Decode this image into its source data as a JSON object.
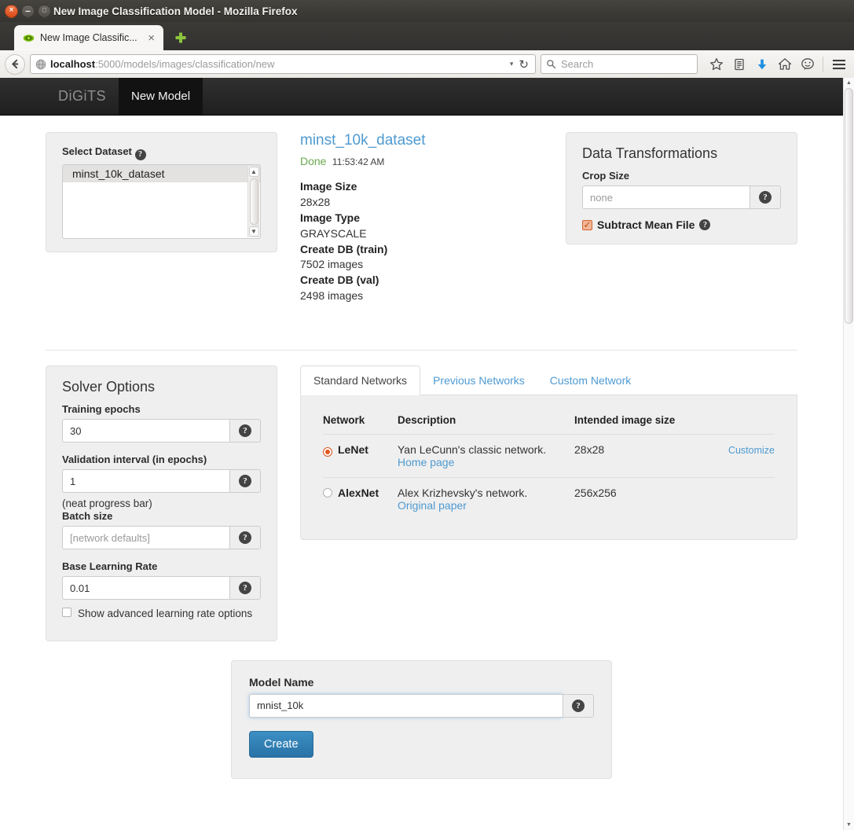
{
  "window": {
    "title": "New Image Classification Model - Mozilla Firefox",
    "close_glyph": "×",
    "minimize_glyph": "–",
    "maximize_glyph": "□"
  },
  "browser": {
    "tab": {
      "title": "New Image Classific...",
      "close_glyph": "×",
      "favicon": "nvidia-eye-icon"
    },
    "new_tab_glyph": "+",
    "back_glyph": "←",
    "url": {
      "host": "localhost",
      "path": ":5000/models/images/classification/new"
    },
    "url_dropdown_glyph": "▾",
    "reload_glyph": "↻",
    "search": {
      "placeholder": "Search",
      "icon": "search-icon"
    },
    "icons": [
      "bookmark-star-icon",
      "reader-icon",
      "downloads-arrow-icon",
      "home-icon",
      "chat-bubble-icon",
      "hamburger-menu-icon"
    ]
  },
  "app_nav": {
    "brand": "DiGiTS",
    "active_tab": "New Model"
  },
  "select_dataset": {
    "heading": "Select Dataset",
    "help_glyph": "?",
    "items": [
      "minst_10k_dataset"
    ],
    "selected": "minst_10k_dataset",
    "scroll_up_glyph": "▲",
    "scroll_down_glyph": "▼"
  },
  "dataset_info": {
    "name": "minst_10k_dataset",
    "status": "Done",
    "timestamp": "11:53:42 AM",
    "fields": [
      {
        "key": "Image Size",
        "value": "28x28"
      },
      {
        "key": "Image Type",
        "value": "GRAYSCALE"
      },
      {
        "key": "Create DB (train)",
        "value": "7502 images"
      },
      {
        "key": "Create DB (val)",
        "value": "2498 images"
      }
    ]
  },
  "data_transformations": {
    "heading": "Data Transformations",
    "crop_size_label": "Crop Size",
    "crop_size_value": "",
    "crop_size_placeholder": "none",
    "crop_size_help_glyph": "?",
    "subtract_mean_label": "Subtract Mean File",
    "subtract_mean_checked": true,
    "subtract_mean_check_glyph": "✓",
    "subtract_mean_help_glyph": "?"
  },
  "solver_options": {
    "heading": "Solver Options",
    "fields": [
      {
        "label": "Training epochs",
        "value": "30",
        "placeholder": "",
        "help_glyph": "?"
      },
      {
        "label": "Validation interval (in epochs)",
        "value": "1",
        "placeholder": "",
        "help_glyph": "?"
      }
    ],
    "note": "(neat progress bar)",
    "batch_size_label": "Batch size",
    "batch_size_value": "",
    "batch_size_placeholder": "[network defaults]",
    "batch_size_help_glyph": "?",
    "base_lr_label": "Base Learning Rate",
    "base_lr_value": "0.01",
    "base_lr_help_glyph": "?",
    "advanced_label": "Show advanced learning rate options",
    "advanced_checked": false
  },
  "networks": {
    "tabs": [
      {
        "label": "Standard Networks",
        "active": true
      },
      {
        "label": "Previous Networks",
        "active": false
      },
      {
        "label": "Custom Network",
        "active": false
      }
    ],
    "columns": [
      "Network",
      "Description",
      "Intended image size",
      ""
    ],
    "rows": [
      {
        "selected": true,
        "name": "LeNet",
        "description": "Yan LeCunn's classic network.",
        "link": "Home page",
        "image_size": "28x28",
        "action": "Customize"
      },
      {
        "selected": false,
        "name": "AlexNet",
        "description": "Alex Krizhevsky's network.",
        "link": "Original paper",
        "image_size": "256x256",
        "action": ""
      }
    ]
  },
  "model_name": {
    "label": "Model Name",
    "value": "mnist_10k",
    "help_glyph": "?",
    "create_label": "Create"
  },
  "colors": {
    "link": "#4e9ad1",
    "accent_orange": "#e2561f",
    "status_green": "#6aa84f",
    "button_blue": "#2e7db2"
  }
}
